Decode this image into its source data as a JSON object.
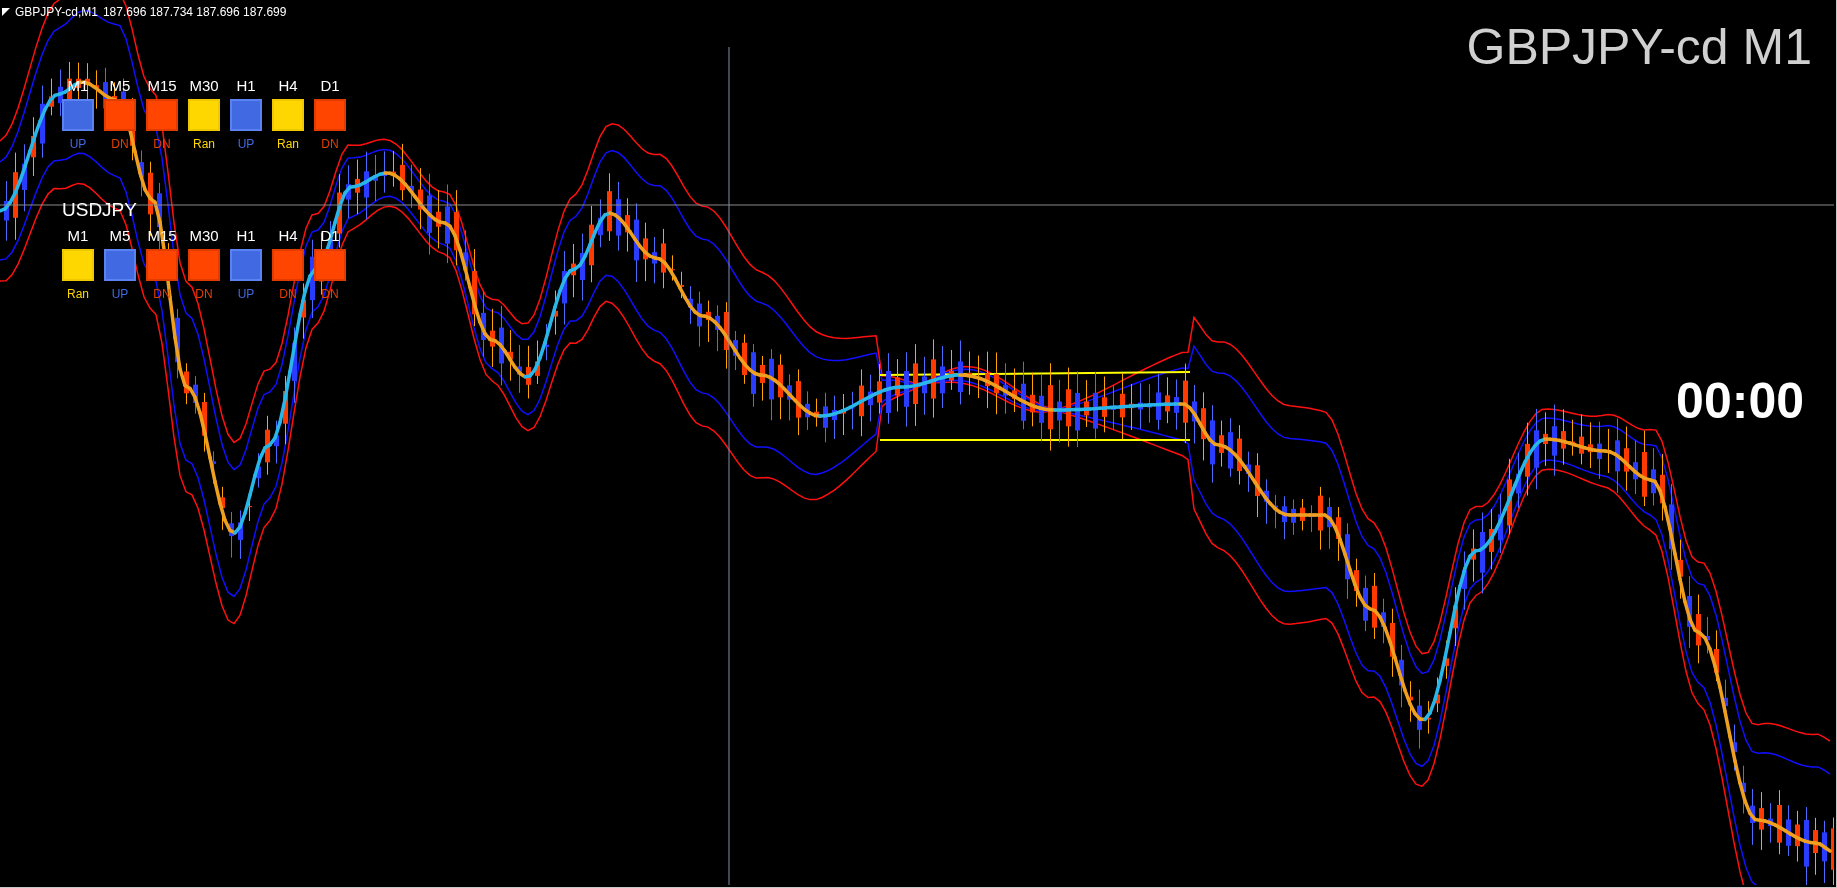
{
  "chart_header": {
    "symbol": "GBPJPY-cd,M1",
    "prices": "187.696 187.734 187.696 187.699"
  },
  "symbol_label": "GBPJPY-cd M1",
  "countdown": "00:00",
  "signal_panels": [
    {
      "timeframes": [
        {
          "label": "M1",
          "kind": "up",
          "signal": "UP"
        },
        {
          "label": "M5",
          "kind": "dn",
          "signal": "DN"
        },
        {
          "label": "M15",
          "kind": "dn",
          "signal": "DN"
        },
        {
          "label": "M30",
          "kind": "ran",
          "signal": "Ran"
        },
        {
          "label": "H1",
          "kind": "up",
          "signal": "UP"
        },
        {
          "label": "H4",
          "kind": "ran",
          "signal": "Ran"
        },
        {
          "label": "D1",
          "kind": "dn",
          "signal": "DN"
        }
      ]
    },
    {
      "title": "USDJPY",
      "timeframes": [
        {
          "label": "M1",
          "kind": "ran",
          "signal": "Ran"
        },
        {
          "label": "M5",
          "kind": "up",
          "signal": "UP"
        },
        {
          "label": "M15",
          "kind": "dn",
          "signal": "DN"
        },
        {
          "label": "M30",
          "kind": "dn",
          "signal": "DN"
        },
        {
          "label": "H1",
          "kind": "up",
          "signal": "UP"
        },
        {
          "label": "H4",
          "kind": "dn",
          "signal": "DN"
        },
        {
          "label": "D1",
          "kind": "dn",
          "signal": "DN"
        }
      ]
    }
  ]
}
